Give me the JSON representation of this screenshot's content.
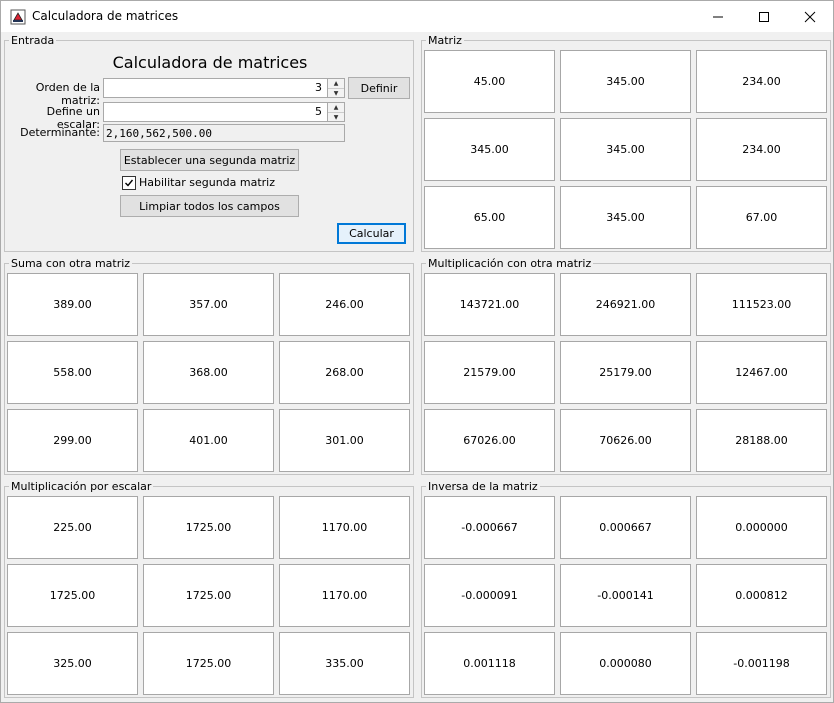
{
  "window": {
    "title": "Calculadora de matrices"
  },
  "entrada": {
    "section_title": "Entrada",
    "heading": "Calculadora de matrices",
    "orden_label": "Orden de la matriz:",
    "orden_value": "3",
    "definir_button": "Definir",
    "escalar_label": "Define un escalar:",
    "escalar_value": "5",
    "determinante_label": "Determinante:",
    "determinante_value": "2,160,562,500.00",
    "segunda_matriz_button": "Establecer una segunda matriz",
    "habilitar_label": "Habilitar segunda matriz",
    "habilitar_checked": true,
    "limpiar_button": "Limpiar todos los campos",
    "calcular_button": "Calcular"
  },
  "panels": {
    "matriz": {
      "title": "Matriz",
      "cells": [
        "45.00",
        "345.00",
        "234.00",
        "345.00",
        "345.00",
        "234.00",
        "65.00",
        "345.00",
        "67.00"
      ]
    },
    "suma": {
      "title": "Suma con otra matriz",
      "cells": [
        "389.00",
        "357.00",
        "246.00",
        "558.00",
        "368.00",
        "268.00",
        "299.00",
        "401.00",
        "301.00"
      ]
    },
    "multiplicacion": {
      "title": "Multiplicación con otra matriz",
      "cells": [
        "143721.00",
        "246921.00",
        "111523.00",
        "21579.00",
        "25179.00",
        "12467.00",
        "67026.00",
        "70626.00",
        "28188.00"
      ]
    },
    "escalar": {
      "title": "Multiplicación por escalar",
      "cells": [
        "225.00",
        "1725.00",
        "1170.00",
        "1725.00",
        "1725.00",
        "1170.00",
        "325.00",
        "1725.00",
        "335.00"
      ]
    },
    "inversa": {
      "title": "Inversa de la matriz",
      "cells": [
        "-0.000667",
        "0.000667",
        "0.000000",
        "-0.000091",
        "-0.000141",
        "0.000812",
        "0.001118",
        "0.000080",
        "-0.001198"
      ]
    }
  },
  "icons": {
    "app": "java-app-icon",
    "minimize": "minimize-icon",
    "maximize": "maximize-icon",
    "close": "close-icon",
    "check": "checkmark-icon"
  }
}
